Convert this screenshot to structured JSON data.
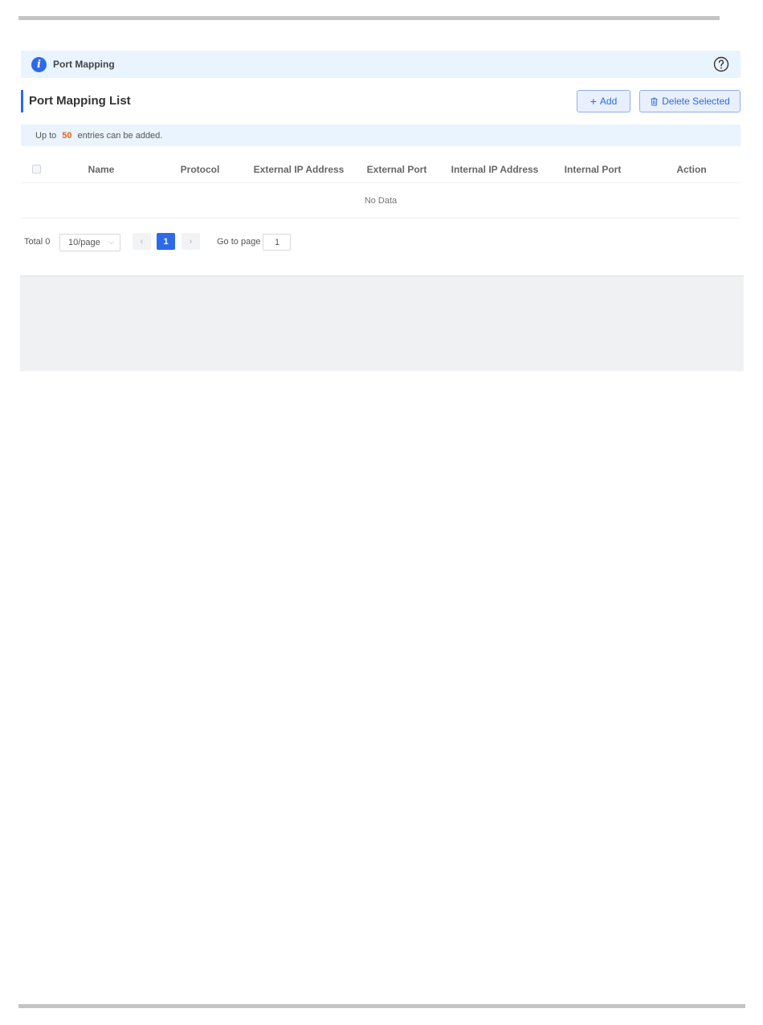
{
  "info_bar": {
    "title": "Port Mapping",
    "icon": "info-icon",
    "help_icon": "help-circle-icon"
  },
  "section": {
    "title": "Port Mapping List"
  },
  "toolbar": {
    "add_label": "Add",
    "add_glyph": "+",
    "delete_label": "Delete Selected",
    "delete_icon": "trash-icon"
  },
  "limit": {
    "prefix": "Up to",
    "count": "50",
    "suffix": "entries can be added."
  },
  "table": {
    "columns": [
      "Name",
      "Protocol",
      "External IP Address",
      "External Port",
      "Internal IP Address",
      "Internal Port",
      "Action"
    ],
    "empty_text": "No Data"
  },
  "pagination": {
    "total_label": "Total 0",
    "page_size": "10/page",
    "prev_glyph": "‹",
    "next_glyph": "›",
    "current_page": "1",
    "goto_label": "Go to page",
    "goto_value": "1"
  },
  "colors": {
    "accent": "#2d6ae8",
    "highlight": "#e8661a",
    "info_bg": "#eaf4fe"
  }
}
